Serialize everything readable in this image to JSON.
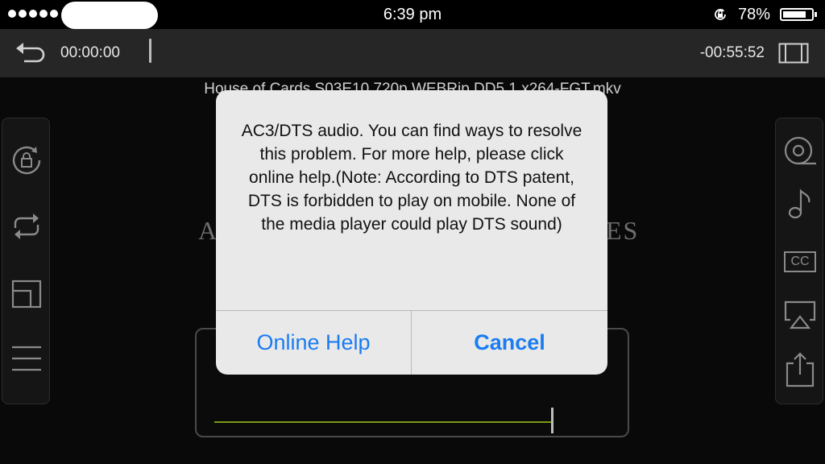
{
  "status": {
    "time": "6:39 pm",
    "battery": "78%"
  },
  "player": {
    "elapsed": "00:00:00",
    "remaining": "-00:55:52",
    "filename": "House of Cards S03E10 720p WEBRip DD5.1 x264-FGT.mkv",
    "bg_title_left": "A",
    "bg_title_right": "ES",
    "progress_fraction": 0.0
  },
  "icons": {
    "left": [
      "rotation-lock-icon",
      "repeat-icon",
      "aspect-ratio-icon",
      "menu-icon"
    ],
    "right": [
      "disc-icon",
      "music-note-icon",
      "closed-caption-icon",
      "airplay-icon",
      "share-icon"
    ],
    "cc_label": "CC"
  },
  "alert": {
    "message": "AC3/DTS audio. You can find ways to resolve this problem. For more help, please click online help.(Note: According to DTS patent, DTS is forbidden to play on mobile. None of the media player could play DTS sound)",
    "help_label": "Online Help",
    "cancel_label": "Cancel"
  },
  "colors": {
    "accent": "#1a7cf2",
    "progress": "#7a9a16"
  }
}
